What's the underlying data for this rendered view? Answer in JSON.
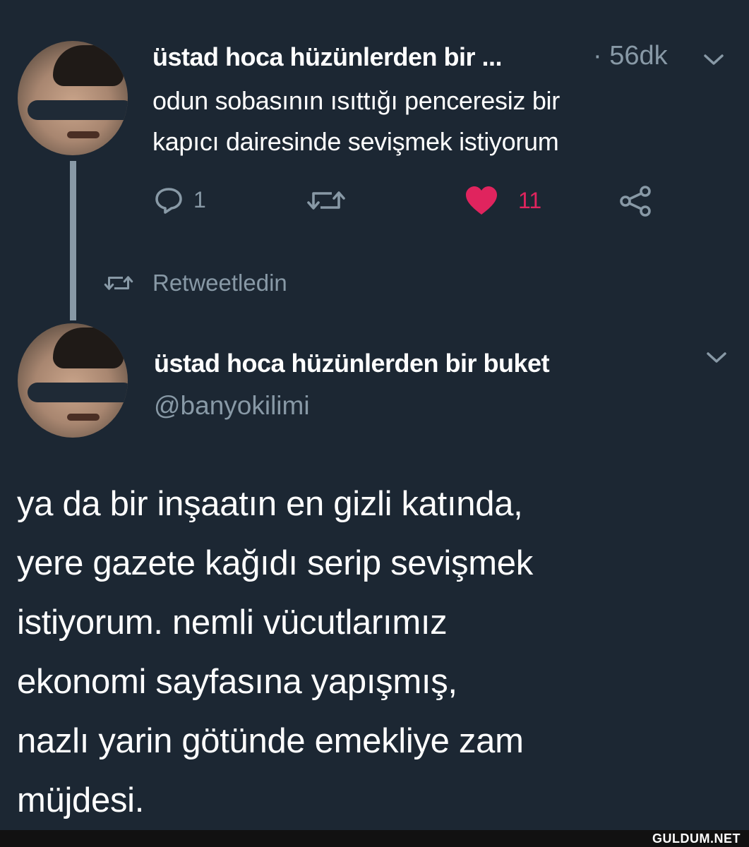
{
  "tweet1": {
    "display_name": "üstad hoca hüzünlerden bir ...",
    "time": "· 56dk",
    "text_line1": "odun sobasının ısıttığı penceresiz bir",
    "text_line2": "kapıcı dairesinde sevişmek istiyorum",
    "reply_count": "1",
    "like_count": "11",
    "like_color": "#e0245e"
  },
  "retweet_context": {
    "label": "Retweetledin"
  },
  "tweet2": {
    "display_name": "üstad hoca hüzünlerden bir buket",
    "handle": "@banyokilimi",
    "text_lines": [
      "ya da bir inşaatın en gizli katında,",
      "yere gazete kağıdı serip sevişmek",
      "istiyorum. nemli vücutlarımız",
      "ekonomi sayfasına yapışmış,",
      "nazlı yarin götünde emekliye zam",
      "müjdesi."
    ]
  },
  "watermark": "GULDUM.NET",
  "icons": {
    "reply": "reply-icon",
    "retweet": "retweet-icon",
    "like": "heart-icon",
    "share": "share-icon",
    "caret": "chevron-down-icon"
  },
  "colors": {
    "background": "#1c2733",
    "muted": "#8899a6",
    "like": "#e0245e"
  }
}
